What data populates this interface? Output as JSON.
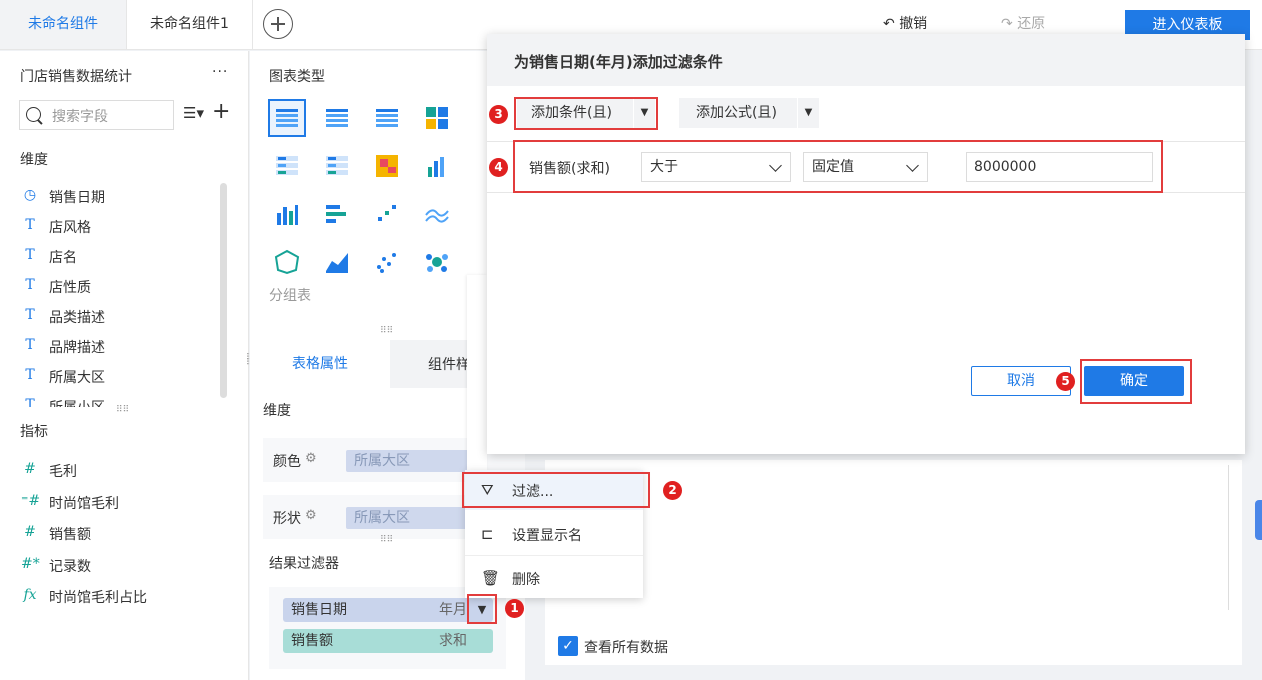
{
  "tabs": [
    {
      "label": "未命名组件",
      "active": true
    },
    {
      "label": "未命名组件1",
      "active": false
    }
  ],
  "toolbar": {
    "undo": "撤销",
    "redo": "还原",
    "enter_dashboard": "进入仪表板"
  },
  "dataset": {
    "title": "门店销售数据统计",
    "more": "···",
    "search_placeholder": "搜索字段"
  },
  "dimensions": {
    "label": "维度",
    "items": [
      {
        "icon": "clock-icon",
        "glyph": "◷",
        "label": "销售日期"
      },
      {
        "icon": "text-icon",
        "glyph": "T",
        "label": "店风格"
      },
      {
        "icon": "text-icon",
        "glyph": "T",
        "label": "店名"
      },
      {
        "icon": "text-icon",
        "glyph": "T",
        "label": "店性质"
      },
      {
        "icon": "text-icon",
        "glyph": "T",
        "label": "品类描述"
      },
      {
        "icon": "text-icon",
        "glyph": "T",
        "label": "品牌描述"
      },
      {
        "icon": "text-icon",
        "glyph": "T",
        "label": "所属大区"
      },
      {
        "icon": "text-icon",
        "glyph": "T",
        "label": "所属小区"
      }
    ]
  },
  "measures": {
    "label": "指标",
    "items": [
      {
        "icon": "number-icon",
        "glyph": "#",
        "label": "毛利"
      },
      {
        "icon": "number-calc-icon",
        "glyph": "⁼#",
        "label": "时尚馆毛利"
      },
      {
        "icon": "number-icon",
        "glyph": "#",
        "label": "销售额"
      },
      {
        "icon": "record-count-icon",
        "glyph": "#*",
        "label": "记录数"
      },
      {
        "icon": "formula-icon",
        "glyph": "fx",
        "label": "时尚馆毛利占比"
      }
    ]
  },
  "chart_panel": {
    "title": "图表类型",
    "group_table_label": "分组表"
  },
  "props": {
    "tab_active": "表格属性",
    "tab_other": "组件样",
    "dimension_label": "维度",
    "color_label": "颜色",
    "color_field": "所属大区",
    "shape_label": "形状",
    "shape_field": "所属大区"
  },
  "result_filter": {
    "label": "结果过滤器",
    "chips": [
      {
        "field": "销售日期",
        "agg": "年月"
      },
      {
        "field": "销售额",
        "agg": "求和"
      }
    ]
  },
  "context_menu": {
    "items": [
      {
        "icon": "filter-icon",
        "glyph": "⛛",
        "label": "过滤..."
      },
      {
        "icon": "rename-icon",
        "glyph": "⊏",
        "label": "设置显示名"
      },
      {
        "icon": "trash-icon",
        "glyph": "🗑",
        "label": "删除"
      }
    ]
  },
  "dialog": {
    "title": "为销售日期(年月)添加过滤条件",
    "add_condition": "添加条件(且)",
    "add_formula": "添加公式(且)",
    "condition": {
      "field": "销售额(求和)",
      "operator": "大于",
      "value_type": "固定值",
      "value": "8000000"
    },
    "cancel": "取消",
    "ok": "确定"
  },
  "view_all": "查看所有数据",
  "badges": [
    "1",
    "2",
    "3",
    "4",
    "5"
  ],
  "colors": {
    "accent": "#1f7ae6",
    "annotation": "#e23c3c"
  }
}
